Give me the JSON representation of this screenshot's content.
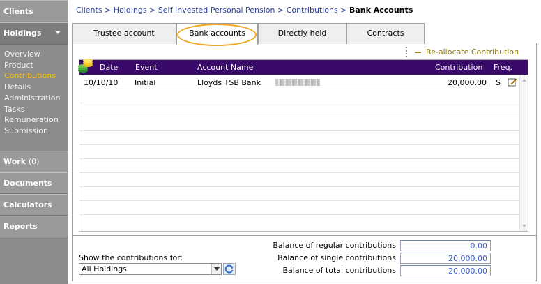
{
  "sidebar": {
    "clients": "Clients",
    "holdings": "Holdings",
    "submenu": [
      "Overview",
      "Product",
      "Contributions",
      "Details",
      "Administration",
      "Tasks",
      "Remuneration",
      "Submission"
    ],
    "active_submenu": "Contributions",
    "work": "Work",
    "work_count": "(0)",
    "documents": "Documents",
    "calculators": "Calculators",
    "reports": "Reports"
  },
  "breadcrumb": {
    "items": [
      "Clients",
      "Holdings",
      "Self Invested Personal Pension",
      "Contributions"
    ],
    "separator": ">",
    "current": "Bank Accounts"
  },
  "tabs": [
    "Trustee account",
    "Bank accounts",
    "Directly held",
    "Contracts"
  ],
  "active_tab": "Bank accounts",
  "toolbar": {
    "reallocate": "Re-allocate Contribution"
  },
  "grid": {
    "headers": {
      "date": "Date",
      "event": "Event",
      "account": "Account Name",
      "contribution": "Contribution",
      "freq": "Freq."
    },
    "rows": [
      {
        "date": "10/10/10",
        "event": "Initial",
        "account": "Lloyds TSB Bank",
        "contribution": "20,000.00",
        "freq": "S"
      }
    ]
  },
  "footer": {
    "show_label": "Show the contributions for:",
    "filter_value": "All Holdings",
    "regular_label": "Balance of regular contributions",
    "regular_value": "0.00",
    "single_label": "Balance of single contributions",
    "single_value": "20,000.00",
    "total_label": "Balance of total contributions",
    "total_value": "20,000.00"
  },
  "colors": {
    "header_bg": "#3a0a6a",
    "active_menu": "#ffc000",
    "link": "#2a3e9c",
    "highlight": "#f0a820"
  }
}
